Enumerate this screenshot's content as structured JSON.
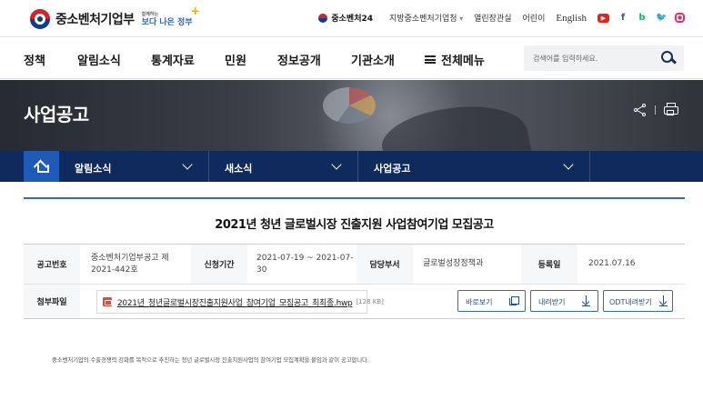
{
  "header": {
    "ministry_name": "중소벤처기업부",
    "slogan_small": "함께하는",
    "slogan_main": "보다 나은 정부",
    "util": {
      "brand24": "중소벤처24",
      "regional_office": "지방중소벤처기업청",
      "open_office": "열린장관실",
      "kids": "어린이",
      "english": "English"
    },
    "sns": [
      "youtube-icon",
      "facebook-icon",
      "blog-icon",
      "twitter-icon",
      "instagram-icon"
    ]
  },
  "gnb": {
    "items": [
      "정책",
      "알림소식",
      "통계자료",
      "민원",
      "정보공개",
      "기관소개"
    ],
    "all_menu": "전체메뉴",
    "search_placeholder": "검색어를 입력하세요."
  },
  "banner": {
    "title": "사업공고"
  },
  "location": {
    "items": [
      {
        "label": "알림소식"
      },
      {
        "label": "새소식"
      },
      {
        "label": "사업공고"
      }
    ]
  },
  "post": {
    "title": "2021년 청년 글로벌시장 진출지원 사업참여기업 모집공고",
    "fields": {
      "notice_no_label": "공고번호",
      "notice_no_value": "중소벤처기업부공고 제2021-442호",
      "period_label": "신청기간",
      "period_value": "2021-07-19 ~ 2021-07-30",
      "dept_label": "담당부서",
      "dept_value": "글로벌성장정책과",
      "reg_label": "등록일",
      "reg_value": "2021.07.16",
      "attach_label": "첨부파일"
    },
    "attachment": {
      "name": "2021년_청년글로벌시장진출지원사업_참여기업_모집공고_최최종.hwp",
      "size": "[128 KB]",
      "view_btn": "바로보기",
      "download_btn": "내려받기",
      "odt_btn": "ODT내려받기"
    },
    "body": "중소벤처기업의 수출경쟁력 강화를 목적으로 추진하는 청년 글로벌시장 진출지원사업의 참여기업 모집계획을 붙임과 같이 공고합니다."
  },
  "colors": {
    "brand_navy": "#0f2a5c",
    "accent_blue": "#2d6bc4",
    "home_blue": "#1e5bb8"
  }
}
